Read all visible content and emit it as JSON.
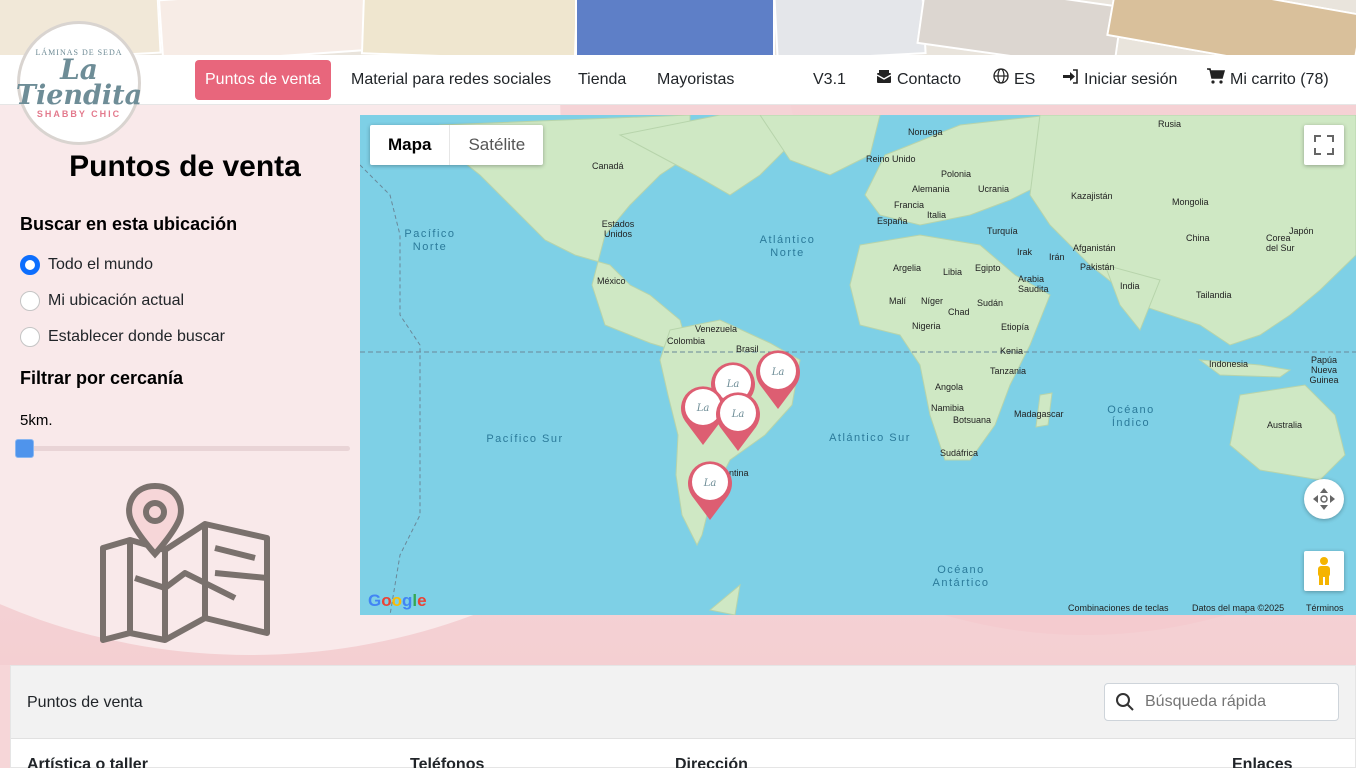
{
  "logo": {
    "ring_top": "LÁMINAS DE SEDA",
    "brand_line1": "La",
    "brand_line2": "Tiendita",
    "ring_bottom": "SHABBY CHIC"
  },
  "nav": {
    "items": [
      {
        "label": "Puntos de venta",
        "active": true
      },
      {
        "label": "Material para redes sociales"
      },
      {
        "label": "Tienda"
      },
      {
        "label": "Mayoristas"
      }
    ],
    "version": "V3.1",
    "contact": "Contacto",
    "language": "ES",
    "login": "Iniciar sesión",
    "cart": "Mi carrito (78)",
    "icons": {
      "contact": "envelope-icon",
      "language": "globe-icon",
      "login": "sign-in-icon",
      "cart": "cart-icon"
    }
  },
  "panel": {
    "title": "Puntos de venta",
    "search_heading": "Buscar en esta ubicación",
    "options": [
      {
        "label": "Todo el mundo",
        "checked": true
      },
      {
        "label": "Mi ubicación actual",
        "checked": false
      },
      {
        "label": "Establecer donde buscar",
        "checked": false
      }
    ],
    "filter_heading": "Filtrar por cercanía",
    "distance_label": "5km."
  },
  "map": {
    "tabs": [
      "Mapa",
      "Satélite"
    ],
    "active_tab": "Mapa",
    "countries": [
      "Rusia",
      "Noruega",
      "Reino Unido",
      "Polonia",
      "Alemania",
      "Ucrania",
      "Francia",
      "Italia",
      "España",
      "Kazajistán",
      "Mongolia",
      "Turquía",
      "Afganistán",
      "Irak",
      "Irán",
      "China",
      "Corea del Sur",
      "Japón",
      "Pakistán",
      "Argelia",
      "Libia",
      "Egipto",
      "Arabia Saudita",
      "India",
      "Tailandia",
      "Malí",
      "Níger",
      "Sudán",
      "Chad",
      "Nigeria",
      "Etiopía",
      "Kenia",
      "Tanzania",
      "Angola",
      "Namibia",
      "Botsuana",
      "Madagascar",
      "Sudáfrica",
      "Indonesia",
      "Papúa Nueva Guinea",
      "Australia",
      "Canadá",
      "Estados Unidos",
      "México",
      "Venezuela",
      "Colombia",
      "Brasil",
      "Argentina"
    ],
    "oceans": [
      "Pacífico Norte",
      "Atlántico Norte",
      "Pacífico Sur",
      "Atlántico Sur",
      "Océano Índico",
      "Océano Antártico"
    ],
    "footer": {
      "shortcuts": "Combinaciones de teclas",
      "data": "Datos del mapa ©2025",
      "terms": "Términos"
    },
    "google": "Google",
    "colors": {
      "water": "#7ed0e6",
      "land": "#cfe8c4",
      "pin": "#dd5e72"
    }
  },
  "table": {
    "title": "Puntos de venta",
    "search_placeholder": "Búsqueda rápida",
    "columns": [
      "Artística o taller",
      "Teléfonos",
      "Dirección",
      "Enlaces"
    ]
  },
  "colors": {
    "accent": "#e8667c",
    "radio_checked": "#0d6efd",
    "slider": "#4f94ec"
  }
}
